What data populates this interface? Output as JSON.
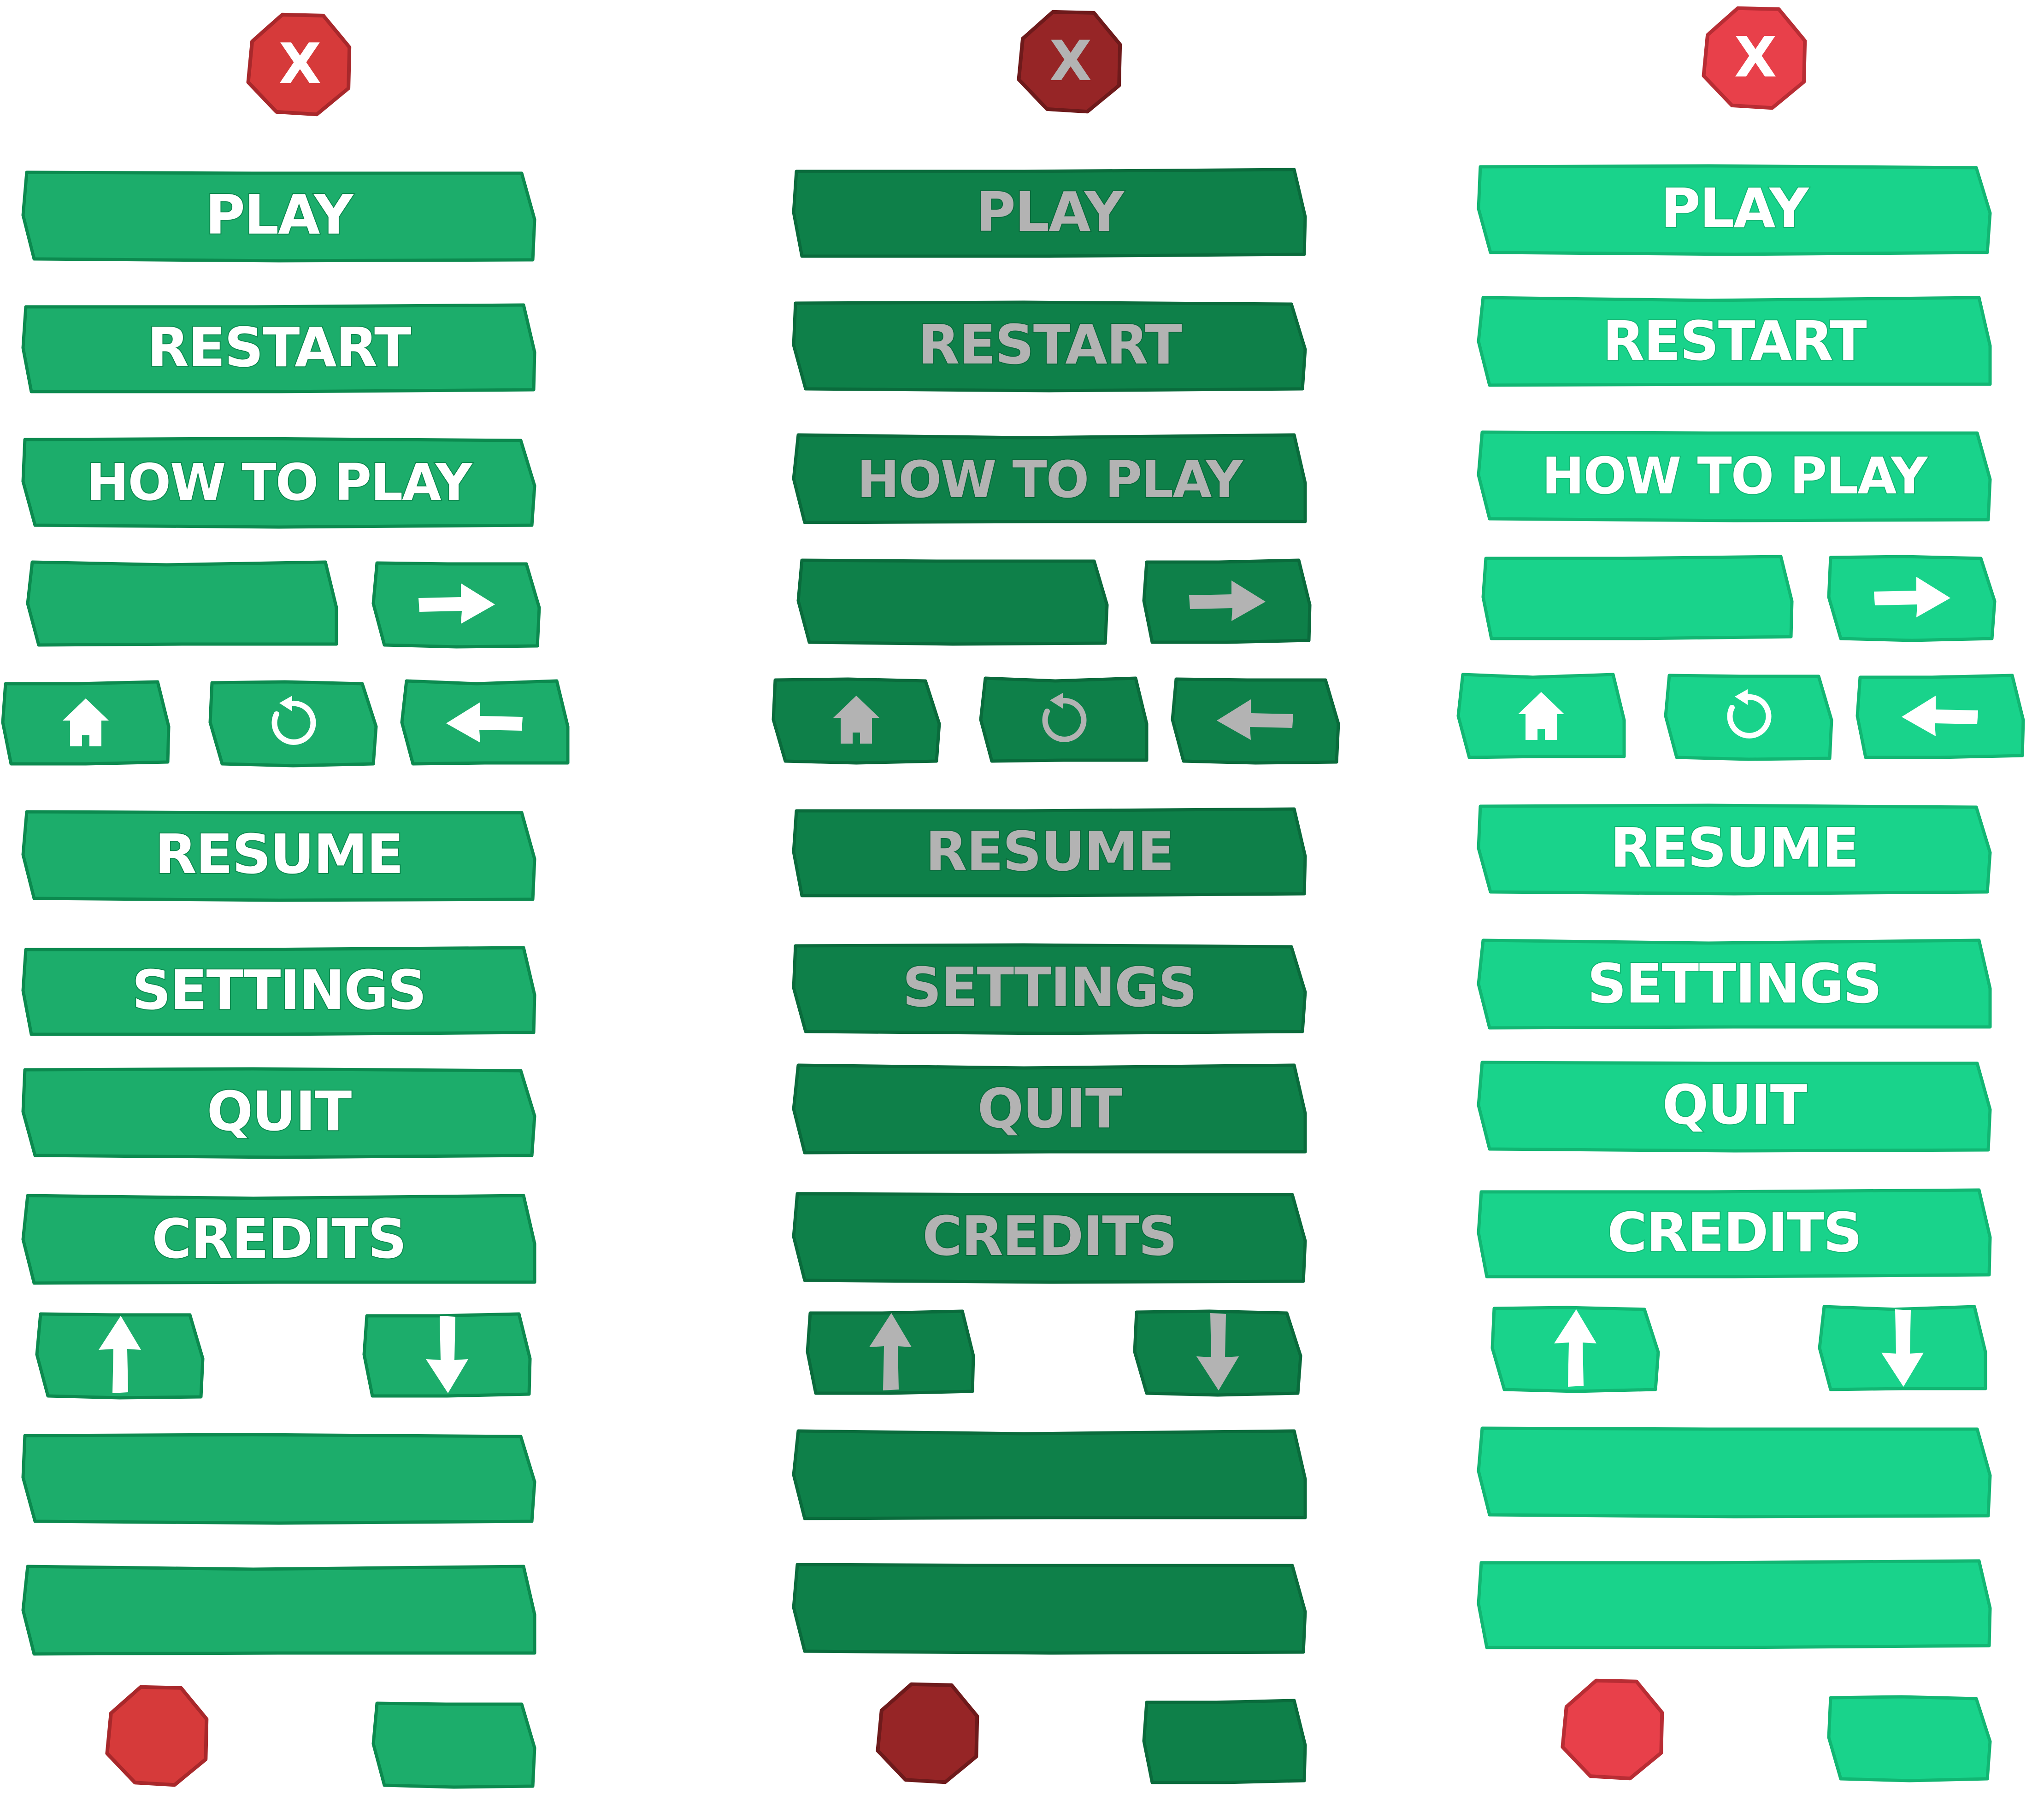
{
  "variants": [
    {
      "state": "normal",
      "colors": {
        "fill": "#1CAD6B",
        "stroke": "#0C8A4F",
        "text": "#FFFFFF",
        "closeFill": "#D63A3A",
        "closeStroke": "#A8282B",
        "closeGlyph": "#FFFFFF"
      }
    },
    {
      "state": "pressed",
      "colors": {
        "fill": "#0E8049",
        "stroke": "#0A6B3C",
        "text": "#B3B3B3",
        "closeFill": "#962526",
        "closeStroke": "#6E1A1B",
        "closeGlyph": "#B3B3B3"
      }
    },
    {
      "state": "hover",
      "colors": {
        "fill": "#19D38B",
        "stroke": "#12B673",
        "text": "#FFFFFF",
        "closeFill": "#E8404A",
        "closeStroke": "#B82D34",
        "closeGlyph": "#FFFFFF"
      }
    }
  ],
  "labels": {
    "close": "X",
    "play": "PLAY",
    "restart": "RESTART",
    "how_to_play": "HOW TO PLAY",
    "resume": "RESUME",
    "settings": "SETTINGS",
    "quit": "QUIT",
    "credits": "CREDITS"
  },
  "icons": {
    "next": "arrow-right-icon",
    "home": "home-icon",
    "replay": "replay-icon",
    "back": "arrow-left-icon",
    "scroll_up": "arrow-up-icon",
    "scroll_down": "arrow-down-icon"
  }
}
